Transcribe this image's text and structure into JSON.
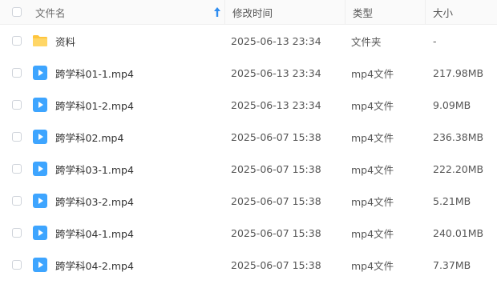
{
  "header": {
    "name_label": "文件名",
    "time_label": "修改时间",
    "type_label": "类型",
    "size_label": "大小",
    "sort_icon": "sort-ascending-arrow-icon"
  },
  "colors": {
    "accent": "#2e8cf0",
    "folder": "#ffc53d",
    "video": "#3ea5ff"
  },
  "files": [
    {
      "name": "资料",
      "modified": "2025-06-13 23:34",
      "type": "文件夹",
      "size": "-",
      "icon": "folder-icon"
    },
    {
      "name": "跨学科01-1.mp4",
      "modified": "2025-06-13 23:34",
      "type": "mp4文件",
      "size": "217.98MB",
      "icon": "video-file-icon"
    },
    {
      "name": "跨学科01-2.mp4",
      "modified": "2025-06-13 23:34",
      "type": "mp4文件",
      "size": "9.09MB",
      "icon": "video-file-icon"
    },
    {
      "name": "跨学科02.mp4",
      "modified": "2025-06-07 15:38",
      "type": "mp4文件",
      "size": "236.38MB",
      "icon": "video-file-icon"
    },
    {
      "name": "跨学科03-1.mp4",
      "modified": "2025-06-07 15:38",
      "type": "mp4文件",
      "size": "222.20MB",
      "icon": "video-file-icon"
    },
    {
      "name": "跨学科03-2.mp4",
      "modified": "2025-06-07 15:38",
      "type": "mp4文件",
      "size": "5.21MB",
      "icon": "video-file-icon"
    },
    {
      "name": "跨学科04-1.mp4",
      "modified": "2025-06-07 15:38",
      "type": "mp4文件",
      "size": "240.01MB",
      "icon": "video-file-icon"
    },
    {
      "name": "跨学科04-2.mp4",
      "modified": "2025-06-07 15:38",
      "type": "mp4文件",
      "size": "7.37MB",
      "icon": "video-file-icon"
    }
  ]
}
